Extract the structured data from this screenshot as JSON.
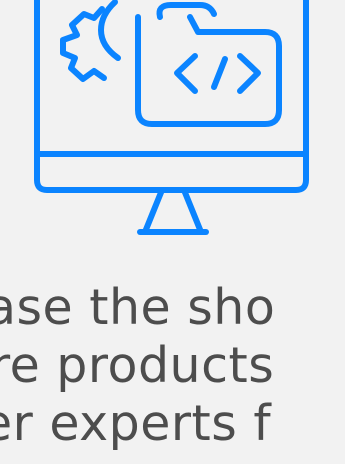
{
  "illustration": {
    "name": "computer-monitor-code-folder-icon",
    "code_glyph": "</>",
    "stroke_color": "#0b84ff"
  },
  "text": {
    "line1": "ase the sho",
    "line2": "re products",
    "line3": "er experts f"
  },
  "colors": {
    "background": "#f2f2f2",
    "text": "#4d4d4d",
    "accent": "#0b84ff"
  }
}
